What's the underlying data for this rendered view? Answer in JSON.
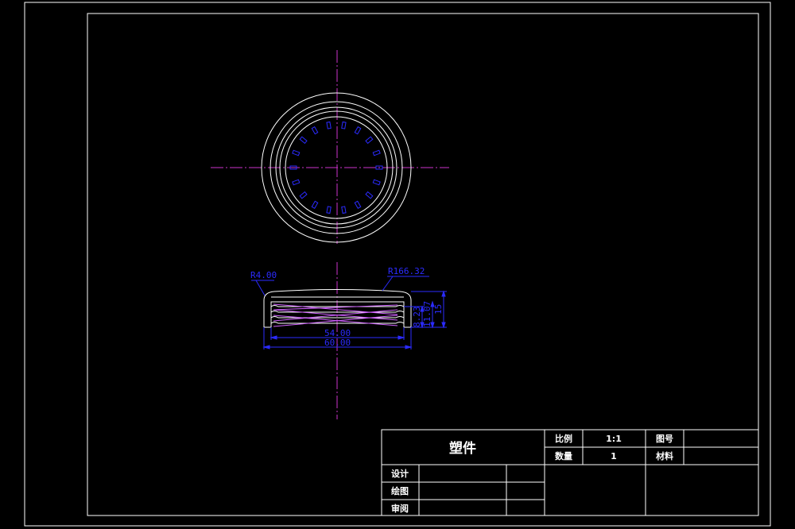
{
  "colors": {
    "background": "#000000",
    "outline": "#ffffff",
    "centerline": "#cc33cc",
    "dimension": "#2b2bff",
    "thread": "#d060ff"
  },
  "drawing": {
    "annotations": {
      "fillet_radius": "R4.00",
      "top_radius": "R166.32",
      "inner_width": "54.00",
      "outer_width": "60.00",
      "dim_small": "8.23",
      "dim_mid": "11.07",
      "dim_height": "15"
    }
  },
  "title_block": {
    "part_name": "塑件",
    "scale_label": "比例",
    "scale_value": "1:1",
    "drawing_no_label": "图号",
    "drawing_no_value": "",
    "quantity_label": "数量",
    "quantity_value": "1",
    "material_label": "材料",
    "material_value": "",
    "design_label": "设计",
    "draw_label": "绘图",
    "review_label": "审阅"
  }
}
